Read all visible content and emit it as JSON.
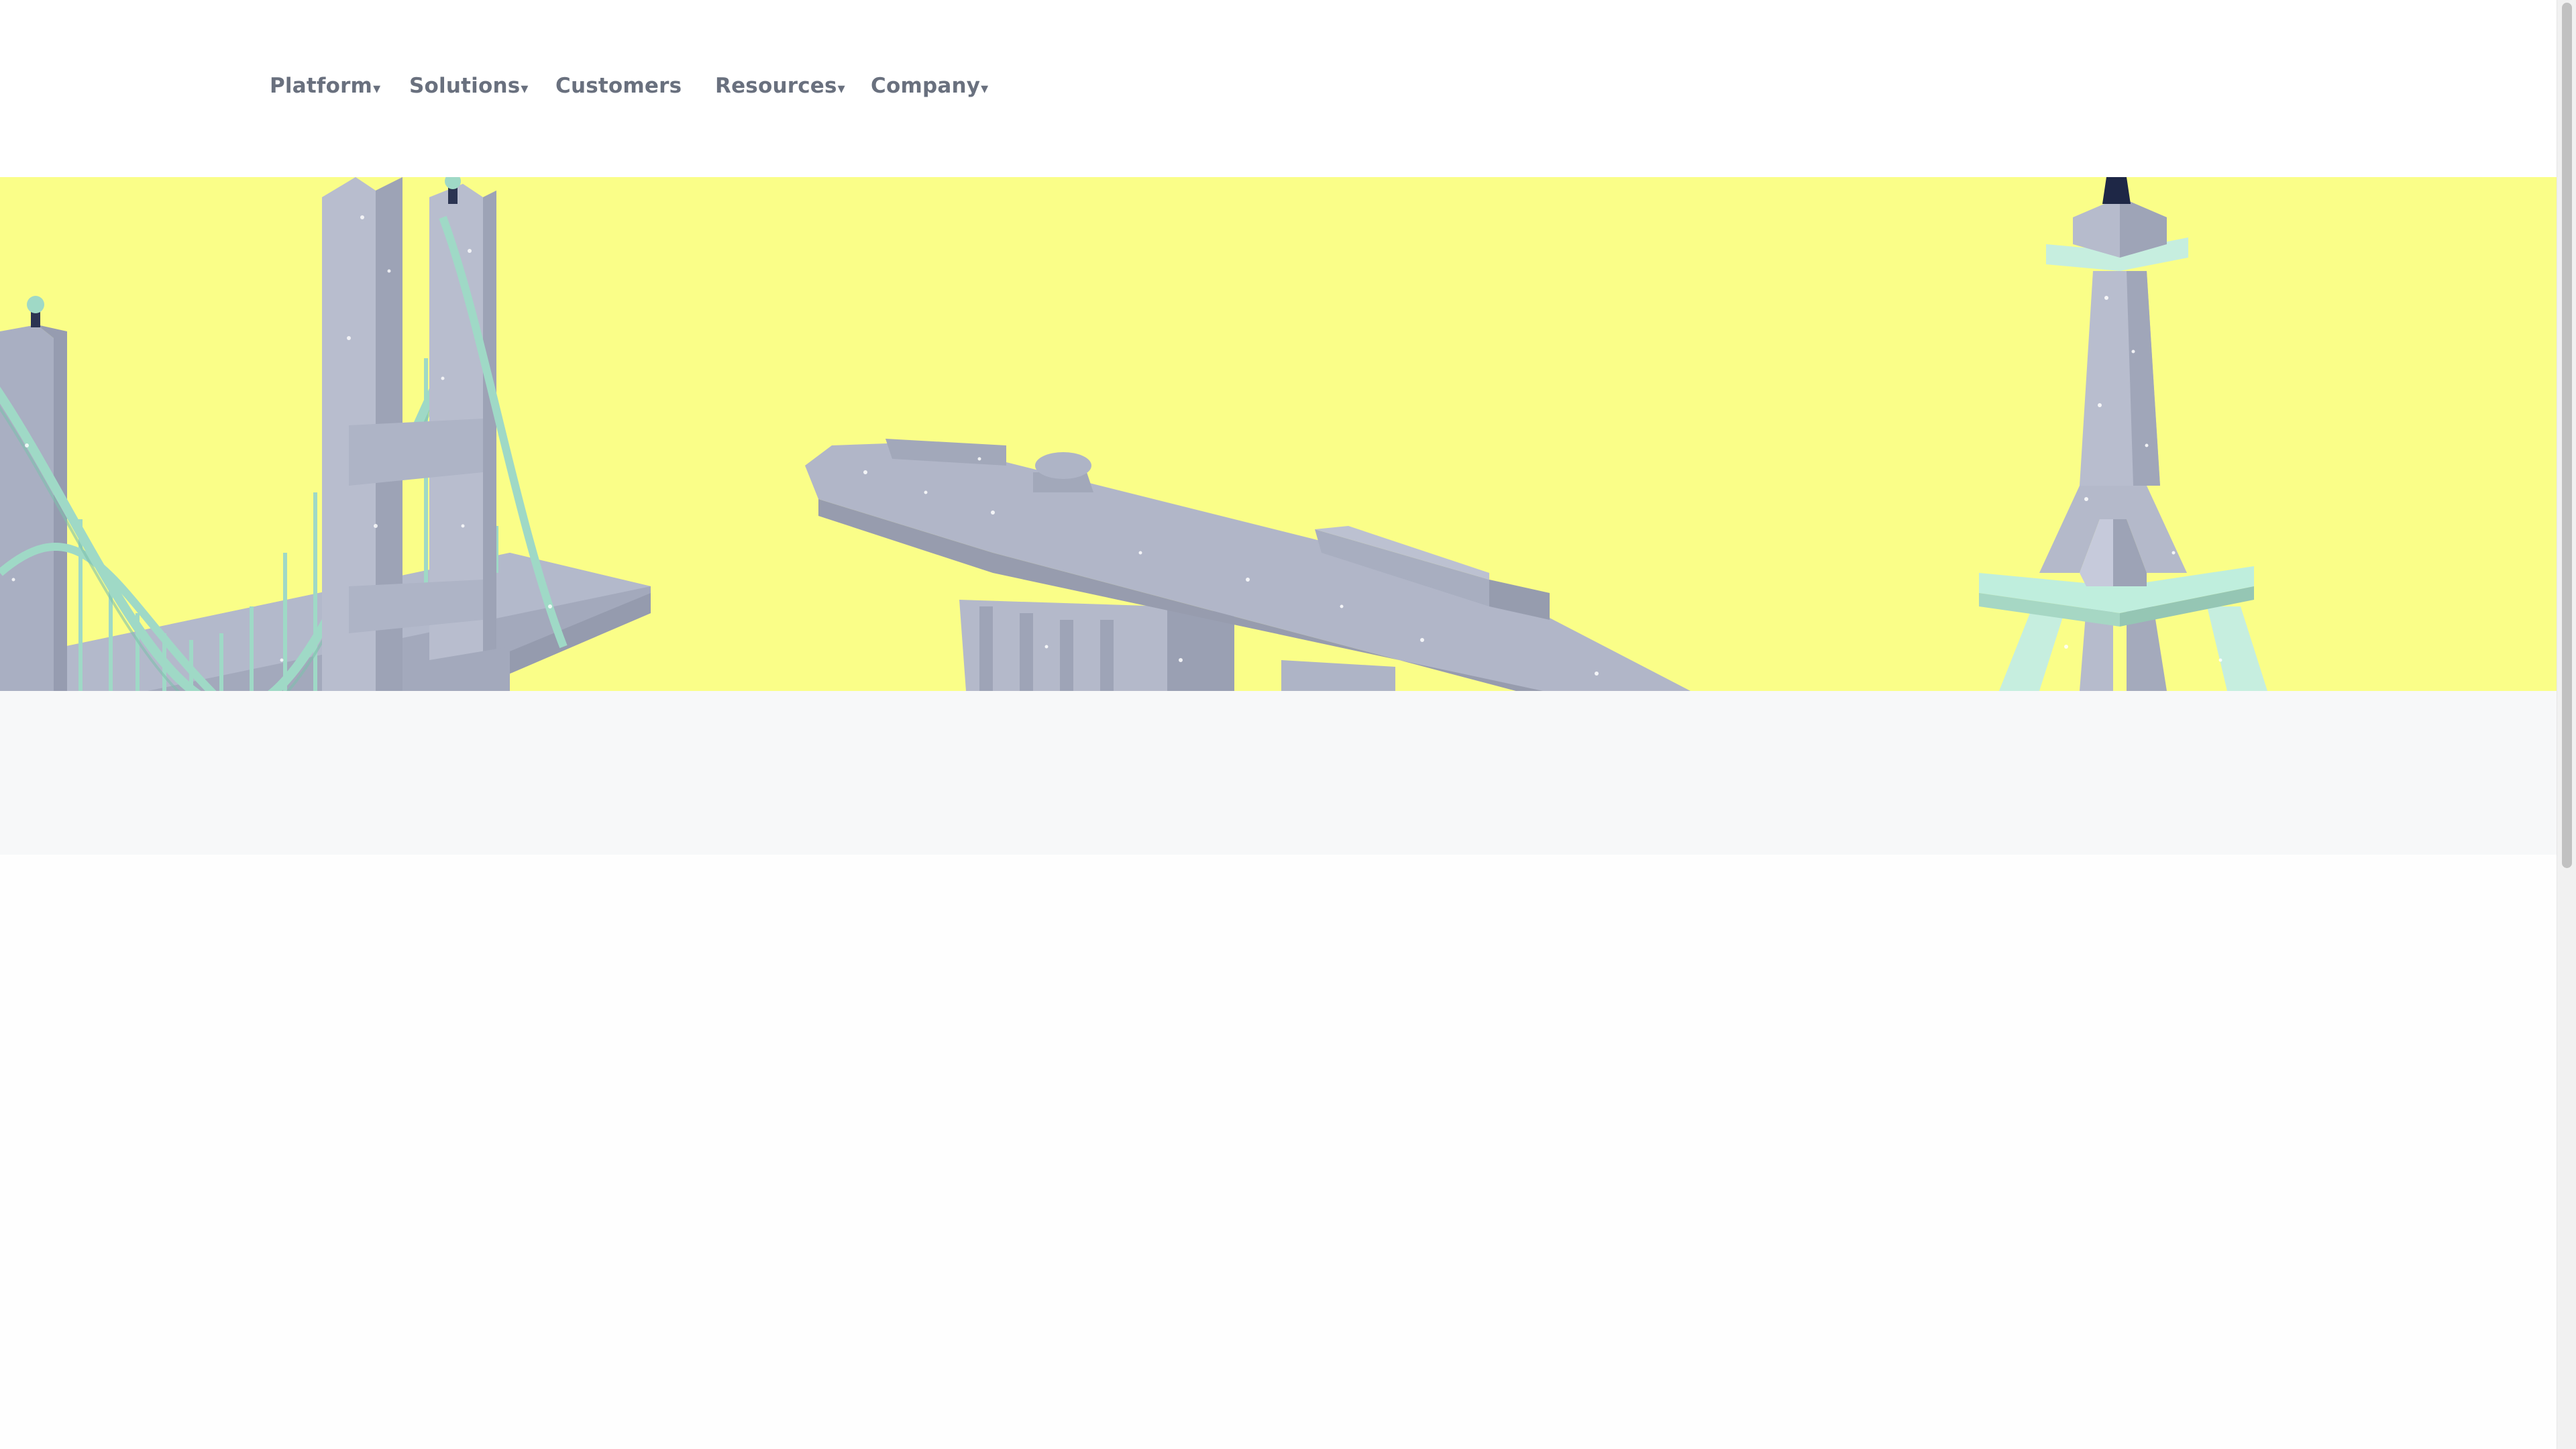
{
  "nav": {
    "items": [
      {
        "label": "Platform",
        "has_dropdown": true
      },
      {
        "label": "Solutions",
        "has_dropdown": true
      },
      {
        "label": "Customers",
        "has_dropdown": false
      },
      {
        "label": "Resources",
        "has_dropdown": true
      },
      {
        "label": "Company",
        "has_dropdown": true
      }
    ],
    "caret": "▾"
  },
  "hero": {
    "illustration_icons": [
      "suspension-bridge-icon",
      "marina-bay-sands-icon",
      "eiffel-tower-icon"
    ]
  },
  "colors": {
    "hero_background": "#fafe88",
    "nav_text": "#69707e",
    "band_background": "#f7f8f9",
    "landmark_grey": "#aeb4c6",
    "landmark_mint": "#bfeedd"
  }
}
